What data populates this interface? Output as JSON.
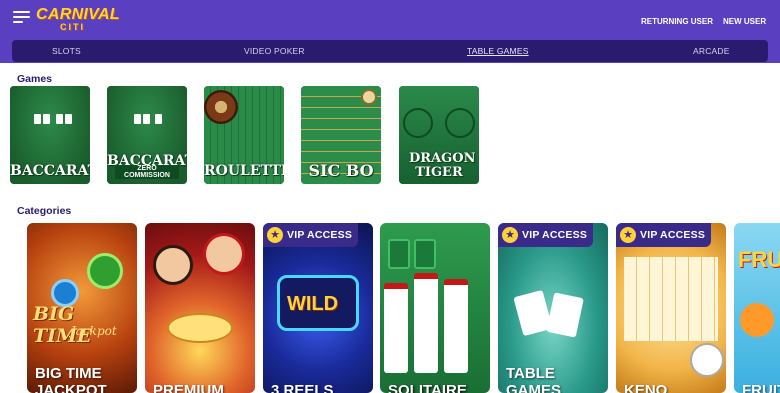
{
  "header": {
    "logo_line1": "CARNIVAL",
    "logo_line2": "CITI",
    "returning_user": "RETURNING USER",
    "new_user": "NEW USER"
  },
  "nav": {
    "tabs": [
      "SLOTS",
      "VIDEO POKER",
      "TABLE GAMES",
      "ARCADE"
    ],
    "active": "TABLE GAMES"
  },
  "games": {
    "heading": "Games",
    "items": [
      {
        "title": "BACCARAT",
        "subtitle": ""
      },
      {
        "title": "BACCARAT",
        "subtitle": "ZERO COMMISSION"
      },
      {
        "title": "ROULETTE",
        "subtitle": ""
      },
      {
        "title": "SIC BO",
        "subtitle": ""
      },
      {
        "title": "DRAGON TIGER",
        "subtitle": ""
      }
    ]
  },
  "categories": {
    "heading": "Categories",
    "vip_label": "VIP ACCESS",
    "items": [
      {
        "title": "BIG TIME JACKPOT",
        "art": "BIG TIME",
        "art2": "Jackpot",
        "vip": false
      },
      {
        "title": "PREMIUM",
        "vip": false
      },
      {
        "title": "3 REELS",
        "art": "WILD",
        "vip": true
      },
      {
        "title": "SOLITAIRE",
        "vip": false
      },
      {
        "title": "TABLE GAMES",
        "vip": true
      },
      {
        "title": "KENO",
        "vip": true
      },
      {
        "title": "FRUIT",
        "art": "FRU",
        "vip": false
      }
    ]
  },
  "colors": {
    "brand": "#5a3fc0",
    "nav": "#2a1b6e",
    "accent": "#ffd23a"
  }
}
